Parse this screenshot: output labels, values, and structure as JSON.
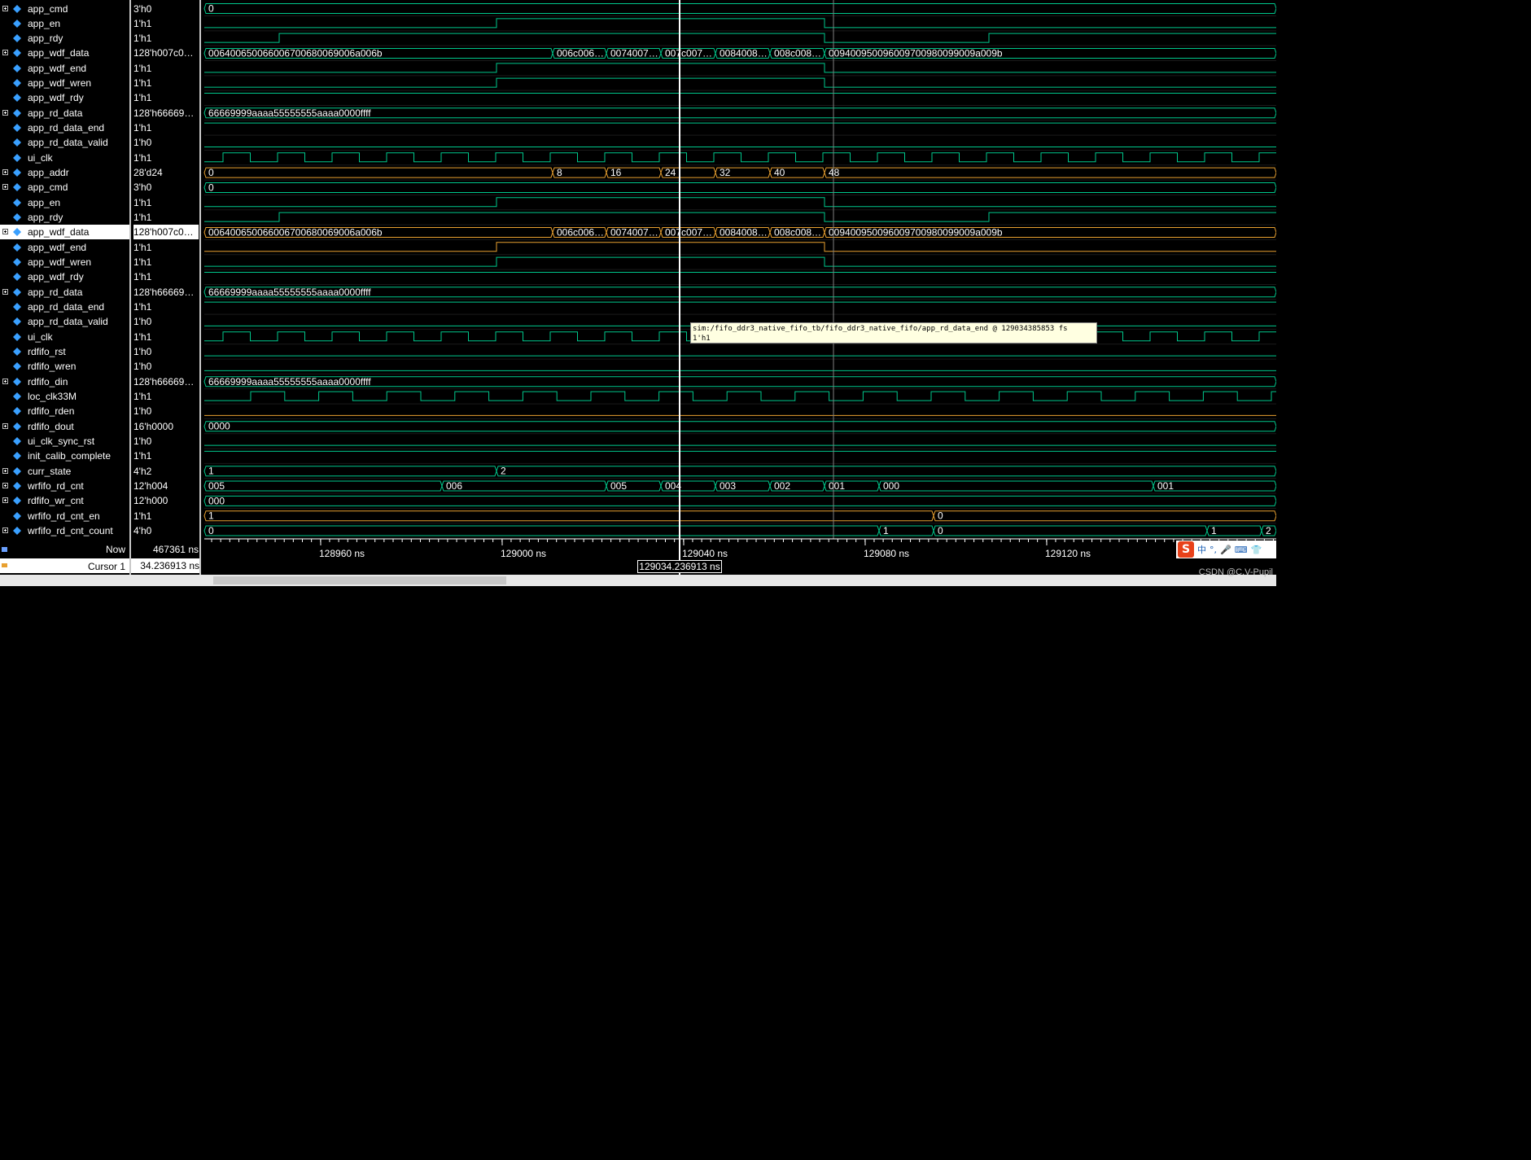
{
  "signals": [
    {
      "name": "app_cmd",
      "value": "3'h0",
      "bus": true
    },
    {
      "name": "app_en",
      "value": "1'h1",
      "bus": false
    },
    {
      "name": "app_rdy",
      "value": "1'h1",
      "bus": false
    },
    {
      "name": "app_wdf_data",
      "value": "128'h007c0…",
      "bus": true
    },
    {
      "name": "app_wdf_end",
      "value": "1'h1",
      "bus": false
    },
    {
      "name": "app_wdf_wren",
      "value": "1'h1",
      "bus": false
    },
    {
      "name": "app_wdf_rdy",
      "value": "1'h1",
      "bus": false
    },
    {
      "name": "app_rd_data",
      "value": "128'h66669…",
      "bus": true
    },
    {
      "name": "app_rd_data_end",
      "value": "1'h1",
      "bus": false
    },
    {
      "name": "app_rd_data_valid",
      "value": "1'h0",
      "bus": false
    },
    {
      "name": "ui_clk",
      "value": "1'h1",
      "bus": false
    },
    {
      "name": "app_addr",
      "value": "28'd24",
      "bus": true
    },
    {
      "name": "app_cmd",
      "value": "3'h0",
      "bus": true
    },
    {
      "name": "app_en",
      "value": "1'h1",
      "bus": false
    },
    {
      "name": "app_rdy",
      "value": "1'h1",
      "bus": false
    },
    {
      "name": "app_wdf_data",
      "value": "128'h007c0…",
      "bus": true,
      "selected": true
    },
    {
      "name": "app_wdf_end",
      "value": "1'h1",
      "bus": false
    },
    {
      "name": "app_wdf_wren",
      "value": "1'h1",
      "bus": false
    },
    {
      "name": "app_wdf_rdy",
      "value": "1'h1",
      "bus": false
    },
    {
      "name": "app_rd_data",
      "value": "128'h66669…",
      "bus": true
    },
    {
      "name": "app_rd_data_end",
      "value": "1'h1",
      "bus": false
    },
    {
      "name": "app_rd_data_valid",
      "value": "1'h0",
      "bus": false
    },
    {
      "name": "ui_clk",
      "value": "1'h1",
      "bus": false
    },
    {
      "name": "rdfifo_rst",
      "value": "1'h0",
      "bus": false
    },
    {
      "name": "rdfifo_wren",
      "value": "1'h0",
      "bus": false
    },
    {
      "name": "rdfifo_din",
      "value": "128'h66669…",
      "bus": true
    },
    {
      "name": "loc_clk33M",
      "value": "1'h1",
      "bus": false
    },
    {
      "name": "rdfifo_rden",
      "value": "1'h0",
      "bus": false
    },
    {
      "name": "rdfifo_dout",
      "value": "16'h0000",
      "bus": true
    },
    {
      "name": "ui_clk_sync_rst",
      "value": "1'h0",
      "bus": false
    },
    {
      "name": "init_calib_complete",
      "value": "1'h1",
      "bus": false
    },
    {
      "name": "curr_state",
      "value": "4'h2",
      "bus": true
    },
    {
      "name": "wrfifo_rd_cnt",
      "value": "12'h004",
      "bus": true
    },
    {
      "name": "rdfifo_wr_cnt",
      "value": "12'h000",
      "bus": true
    },
    {
      "name": "wrfifo_rd_cnt_en",
      "value": "1'h1",
      "bus": false
    },
    {
      "name": "wrfifo_rd_cnt_count",
      "value": "4'h0",
      "bus": true
    }
  ],
  "wave_text": {
    "cmd_0": "0",
    "wdf_seg0": "00640065006600670068006900 6a006b",
    "wdf_seg1": "006c006…",
    "wdf_seg2": "0074007…",
    "wdf_seg3": "007c007…",
    "wdf_seg4": "0084008…",
    "wdf_seg5": "008c008…",
    "wdf_seg6": "009400950096009700980099009a009b",
    "rd_data": "66669999aaaa55555555aaaa0000ffff",
    "addr_0": "0",
    "addr_1": "8",
    "addr_2": "16",
    "addr_3": "24",
    "addr_4": "32",
    "addr_5": "40",
    "addr_6": "48",
    "dout": "0000",
    "state_1": "1",
    "state_2": "2",
    "rdcnt_0": "005",
    "rdcnt_1": "006",
    "rdcnt_2": "005",
    "rdcnt_3": "004",
    "rdcnt_4": "003",
    "rdcnt_5": "002",
    "rdcnt_6": "001",
    "rdcnt_7": "000",
    "rdcnt_8": "001",
    "wrcnt": "000",
    "en_1": "1",
    "en_0": "0",
    "count_0": "0",
    "count_1": "1",
    "count_2": "0",
    "count_3": "1",
    "count_4": "2"
  },
  "timeline": {
    "ticks": [
      "128960 ns",
      "129000 ns",
      "129040 ns",
      "129080 ns",
      "129120 ns"
    ]
  },
  "bottom": {
    "now_label": "Now",
    "now_value": "467361 ns",
    "cursor_label": "Cursor 1",
    "cursor_value": "34.236913 ns",
    "cursor_time": "129034.236913 ns"
  },
  "tooltip": {
    "line1": "sim:/fifo_ddr3_native_fifo_tb/fifo_ddr3_native_fifo/app_rd_data_end @ 129034385853 fs",
    "line2": "1'h1"
  },
  "ime": {
    "logo": "S",
    "items": [
      "中",
      "°,",
      "🎤",
      "⌨",
      "👕"
    ]
  },
  "watermark": "CSDN @C.V-Pupil",
  "colors": {
    "wave": "#00c88c",
    "bus": "#00c88c",
    "bus_orange": "#e8a030",
    "cursor": "#ffffff",
    "text": "#ffffff"
  }
}
